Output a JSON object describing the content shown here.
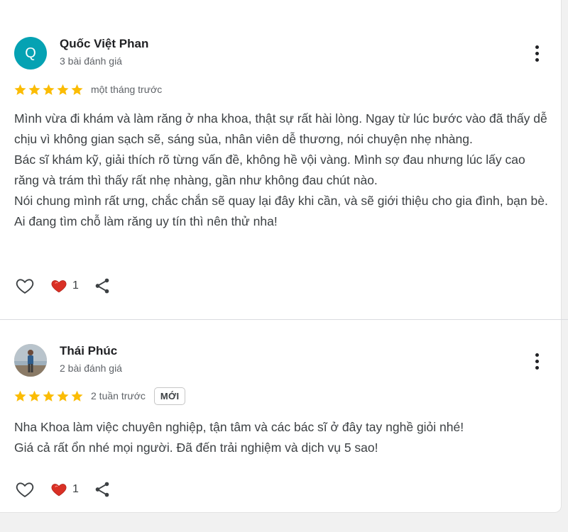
{
  "reviews": [
    {
      "author": "Quốc Việt Phan",
      "avatar_letter": "Q",
      "review_count": "3 bài đánh giá",
      "rating": 5,
      "time": "một tháng trước",
      "text": "Mình vừa đi khám và làm răng ở nha khoa, thật sự rất hài lòng. Ngay từ lúc bước vào đã thấy dễ chịu vì không gian sạch sẽ, sáng sủa, nhân viên dễ thương, nói chuyện nhẹ nhàng.\nBác sĩ khám kỹ, giải thích rõ từng vấn đề, không hề vội vàng. Mình sợ đau nhưng lúc lấy cao răng và trám thì thấy rất nhẹ nhàng, gần như không đau chút nào.\nNói chung mình rất ưng, chắc chắn sẽ quay lại đây khi cần, và sẽ giới thiệu cho gia đình, bạn bè. Ai đang tìm chỗ làm răng uy tín thì nên thử nha!",
      "reaction_count": "1"
    },
    {
      "author": "Thái Phúc",
      "review_count": "2 bài đánh giá",
      "rating": 5,
      "time": "2 tuần trước",
      "badge": "MỚI",
      "text": "Nha Khoa làm việc chuyên nghiệp, tận tâm và các bác sĩ ở đây tay nghề giỏi nhé!\nGiá cả rất ổn nhé mọi người. Đã đến trải nghiệm và dịch vụ 5 sao!",
      "reaction_count": "1"
    }
  ],
  "colors": {
    "star": "#fbbc04",
    "heart": "#d93025",
    "avatar_bg": "#05a2b3"
  },
  "icons": [
    "star-icon",
    "like-heart-icon",
    "love-reaction-icon",
    "share-icon",
    "more-vert-icon"
  ]
}
